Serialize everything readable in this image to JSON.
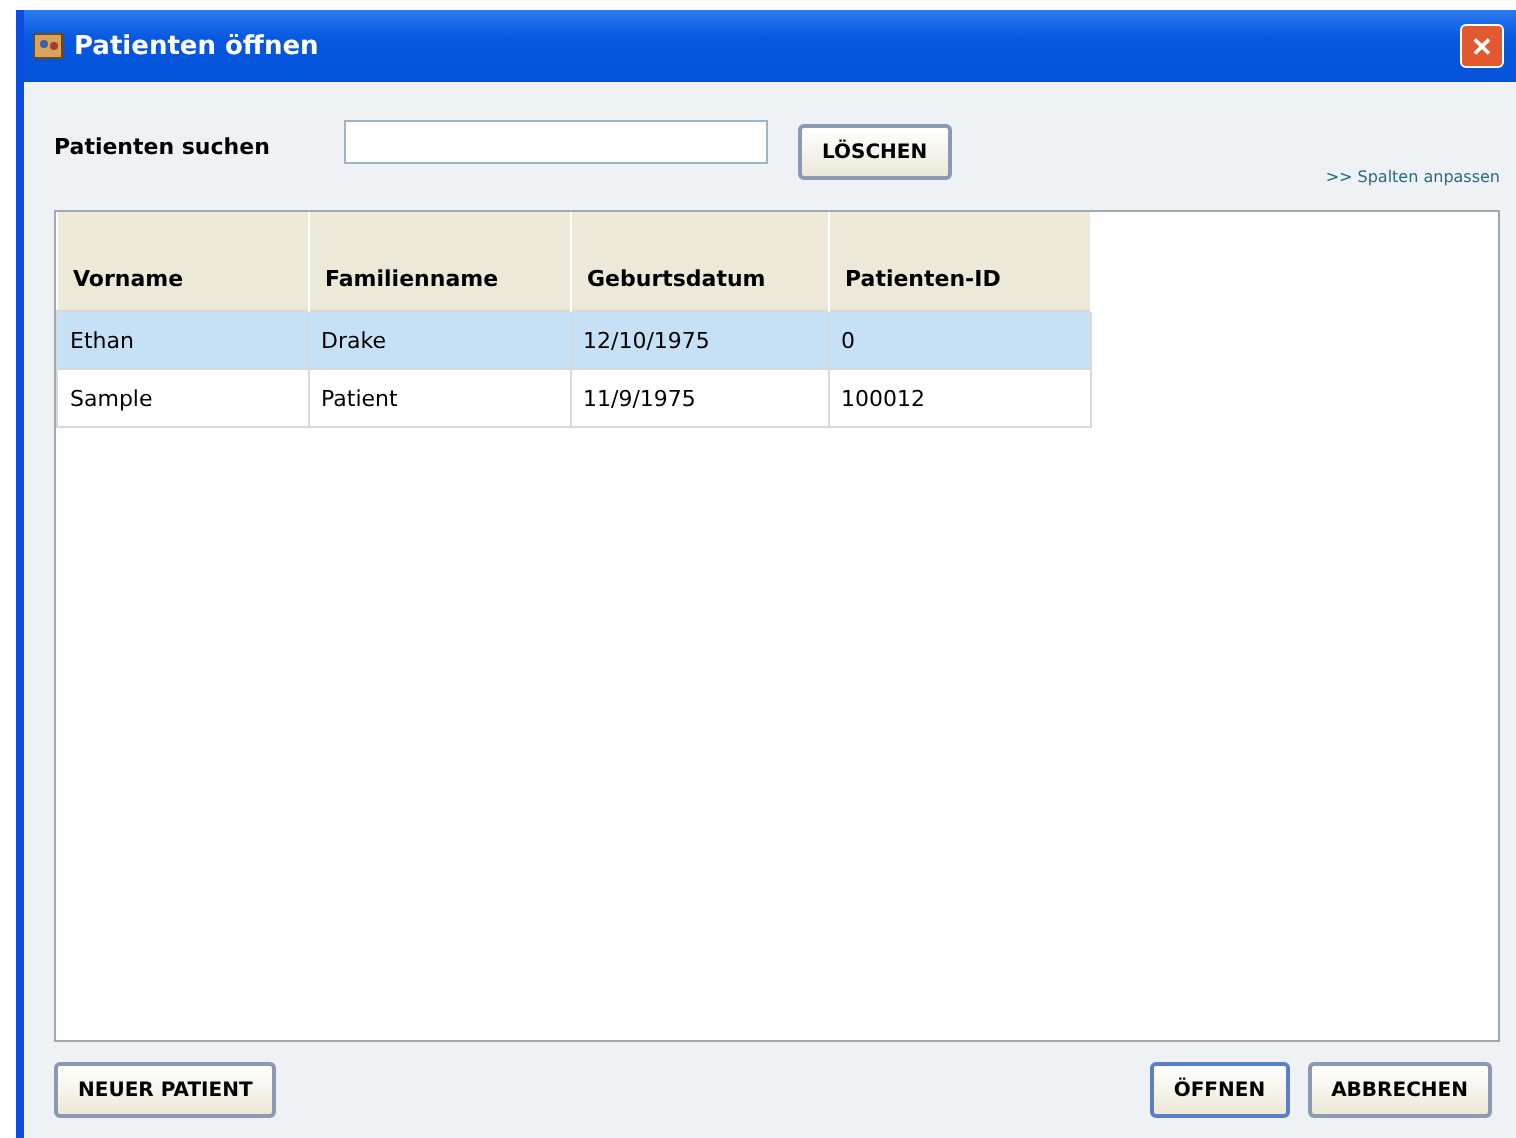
{
  "window": {
    "title": "Patienten öffnen",
    "close": "✕"
  },
  "search": {
    "label": "Patienten suchen",
    "clear_button": "LÖSCHEN"
  },
  "columns_link": ">> Spalten anpassen",
  "table": {
    "columns": [
      "Vorname",
      "Familienname",
      "Geburtsdatum",
      "Patienten-ID"
    ],
    "rows": [
      {
        "cells": [
          "Ethan",
          "Drake",
          "12/10/1975",
          "0"
        ],
        "selected": true
      },
      {
        "cells": [
          "Sample",
          "Patient",
          "11/9/1975",
          "100012"
        ],
        "selected": false
      }
    ]
  },
  "buttons": {
    "new": "NEUER PATIENT",
    "open": "ÖFFNEN",
    "cancel": "ABBRECHEN"
  }
}
